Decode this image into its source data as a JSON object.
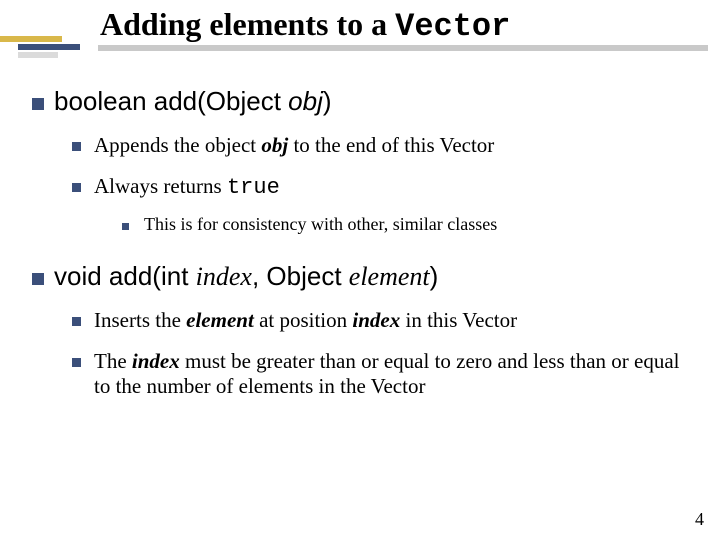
{
  "title_prefix": "Adding elements to a ",
  "title_mono": "Vector",
  "b1": {
    "sig_pre": "boolean add(Object ",
    "sig_arg": "obj",
    "sig_post": ")",
    "sub1_pre": "Appends the object ",
    "sub1_ital": "obj",
    "sub1_post": " to the end of this Vector",
    "sub2_pre": "Always returns ",
    "sub2_mono": "true",
    "sub2a": "This is for consistency with other, similar classes"
  },
  "b2": {
    "sig_pre": "void add(int ",
    "sig_arg1": "index",
    "sig_mid": ", Object ",
    "sig_arg2": "element",
    "sig_post": ")",
    "sub1_a": "Inserts the ",
    "sub1_b": "element",
    "sub1_c": " at position ",
    "sub1_d": "index",
    "sub1_e": " in this Vector",
    "sub2_a": "The ",
    "sub2_b": "index",
    "sub2_c": " must be greater than or equal to zero and less than or equal to the number of elements in the Vector"
  },
  "page_number": "4"
}
